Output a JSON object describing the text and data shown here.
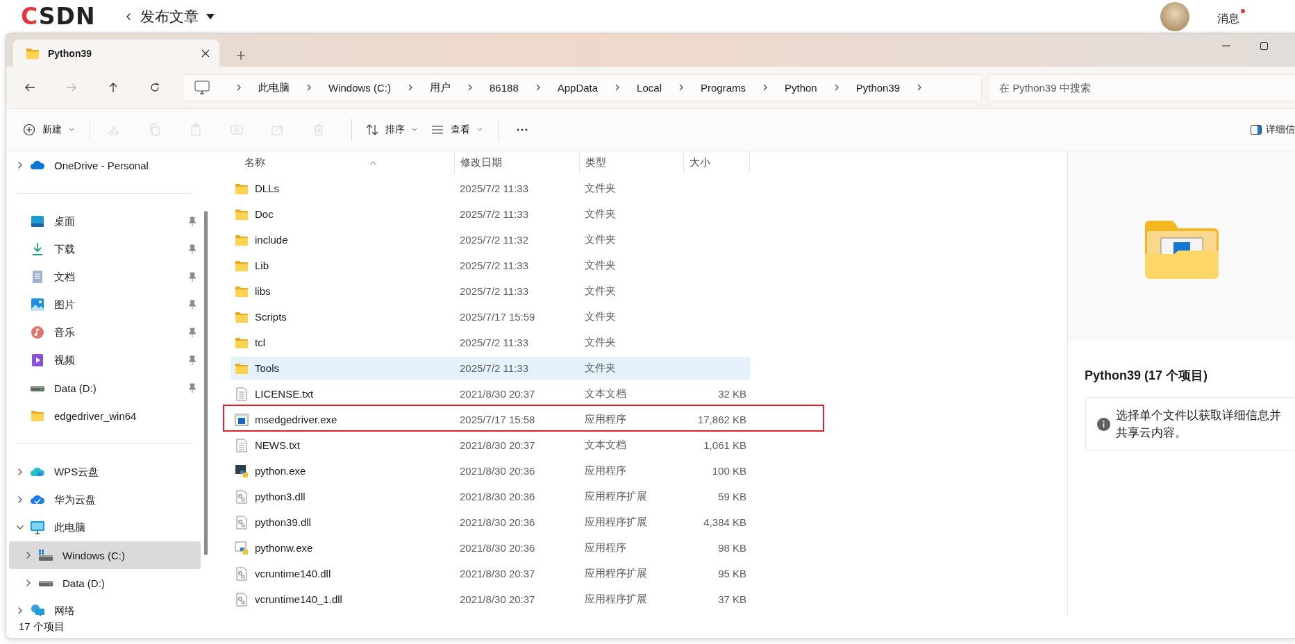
{
  "csdn_bar": {
    "logo": "CSDN",
    "page_title": "发布文章",
    "messages": "消息",
    "unread": true
  },
  "explorer": {
    "tabs": [
      {
        "label": "Python39",
        "selected": true
      }
    ],
    "nav_buttons": [
      {
        "kind": "back",
        "disabled": false
      },
      {
        "kind": "forward",
        "disabled": true
      },
      {
        "kind": "up",
        "disabled": false
      },
      {
        "kind": "refresh",
        "disabled": false
      }
    ],
    "breadcrumb": [
      "此电脑",
      "Windows (C:)",
      "用户",
      "86188",
      "AppData",
      "Local",
      "Programs",
      "Python",
      "Python39"
    ],
    "search": {
      "placeholder": "在 Python39 中搜索"
    },
    "toolbar": [
      {
        "kind": "new",
        "label": "新建",
        "disabled": false
      },
      {
        "kind": "separator"
      },
      {
        "kind": "cut",
        "disabled": true
      },
      {
        "kind": "copy",
        "disabled": true
      },
      {
        "kind": "paste",
        "disabled": true
      },
      {
        "kind": "rename",
        "disabled": true
      },
      {
        "kind": "share",
        "disabled": true
      },
      {
        "kind": "delete",
        "disabled": true
      },
      {
        "kind": "separator"
      },
      {
        "kind": "sort",
        "label": "排序",
        "disabled": false
      },
      {
        "kind": "view",
        "label": "查看",
        "disabled": false
      },
      {
        "kind": "separator"
      },
      {
        "kind": "more",
        "disabled": false
      }
    ],
    "details_toggle": {
      "label": "详细信"
    },
    "sidebar": {
      "sections": [
        [
          {
            "label": "OneDrive - Personal",
            "kind": "onedrive",
            "expanded": false,
            "selected": false
          }
        ],
        [
          {
            "label": "桌面",
            "kind": "desktop",
            "pinned": true,
            "selected": false
          },
          {
            "label": "下载",
            "kind": "download",
            "pinned": true,
            "selected": false
          },
          {
            "label": "文档",
            "kind": "documents",
            "pinned": true,
            "selected": false
          },
          {
            "label": "图片",
            "kind": "pictures",
            "pinned": true,
            "selected": false
          },
          {
            "label": "音乐",
            "kind": "music",
            "pinned": true,
            "selected": false
          },
          {
            "label": "视频",
            "kind": "videos",
            "pinned": true,
            "selected": false
          },
          {
            "label": "Data (D:)",
            "kind": "drive",
            "pinned": true,
            "selected": false
          },
          {
            "label": "edgedriver_win64",
            "kind": "folder",
            "pinned": false,
            "selected": false
          }
        ],
        [
          {
            "label": "WPS云盘",
            "kind": "wps",
            "expanded": false,
            "selected": false
          },
          {
            "label": "华为云盘",
            "kind": "huawei",
            "expanded": false,
            "selected": false
          },
          {
            "label": "此电脑",
            "kind": "pc",
            "expanded": true,
            "selected": false,
            "children": [
              {
                "label": "Windows (C:)",
                "kind": "system_drive",
                "expanded": false,
                "selected": true
              },
              {
                "label": "Data (D:)",
                "kind": "drive",
                "expanded": false,
                "selected": false
              }
            ]
          },
          {
            "label": "网络",
            "kind": "network",
            "expanded": false,
            "selected": false
          }
        ]
      ]
    },
    "columns": [
      {
        "label": "名称",
        "sorted": true
      },
      {
        "label": "修改日期",
        "sorted": false
      },
      {
        "label": "类型",
        "sorted": false
      },
      {
        "label": "大小",
        "sorted": false
      }
    ],
    "rows": [
      {
        "name": "DLLs",
        "modified": "2025/7/2 11:33",
        "type": "文件夹",
        "kind": "folder",
        "hovered": false,
        "outlined": false
      },
      {
        "name": "Doc",
        "modified": "2025/7/2 11:33",
        "type": "文件夹",
        "kind": "folder",
        "hovered": false,
        "outlined": false
      },
      {
        "name": "include",
        "modified": "2025/7/2 11:32",
        "type": "文件夹",
        "kind": "folder",
        "hovered": false,
        "outlined": false
      },
      {
        "name": "Lib",
        "modified": "2025/7/2 11:33",
        "type": "文件夹",
        "kind": "folder",
        "hovered": false,
        "outlined": false
      },
      {
        "name": "libs",
        "modified": "2025/7/2 11:33",
        "type": "文件夹",
        "kind": "folder",
        "hovered": false,
        "outlined": false
      },
      {
        "name": "Scripts",
        "modified": "2025/7/17 15:59",
        "type": "文件夹",
        "kind": "folder",
        "hovered": false,
        "outlined": false
      },
      {
        "name": "tcl",
        "modified": "2025/7/2 11:33",
        "type": "文件夹",
        "kind": "folder",
        "hovered": false,
        "outlined": false
      },
      {
        "name": "Tools",
        "modified": "2025/7/2 11:33",
        "type": "文件夹",
        "kind": "folder",
        "hovered": true,
        "outlined": false
      },
      {
        "name": "LICENSE.txt",
        "modified": "2021/8/30 20:37",
        "type": "文本文档",
        "size": "32 KB",
        "kind": "text",
        "hovered": false,
        "outlined": false
      },
      {
        "name": "msedgedriver.exe",
        "modified": "2025/7/17 15:58",
        "type": "应用程序",
        "size": "17,862 KB",
        "kind": "exe",
        "hovered": false,
        "outlined": true
      },
      {
        "name": "NEWS.txt",
        "modified": "2021/8/30 20:37",
        "type": "文本文档",
        "size": "1,061 KB",
        "kind": "text",
        "hovered": false,
        "outlined": false
      },
      {
        "name": "python.exe",
        "modified": "2021/8/30 20:36",
        "type": "应用程序",
        "size": "100 KB",
        "kind": "python",
        "hovered": false,
        "outlined": false
      },
      {
        "name": "python3.dll",
        "modified": "2021/8/30 20:36",
        "type": "应用程序扩展",
        "size": "59 KB",
        "kind": "dll",
        "hovered": false,
        "outlined": false
      },
      {
        "name": "python39.dll",
        "modified": "2021/8/30 20:36",
        "type": "应用程序扩展",
        "size": "4,384 KB",
        "kind": "dll",
        "hovered": false,
        "outlined": false
      },
      {
        "name": "pythonw.exe",
        "modified": "2021/8/30 20:36",
        "type": "应用程序",
        "size": "98 KB",
        "kind": "pythonw",
        "hovered": false,
        "outlined": false
      },
      {
        "name": "vcruntime140.dll",
        "modified": "2021/8/30 20:37",
        "type": "应用程序扩展",
        "size": "95 KB",
        "kind": "dll",
        "hovered": false,
        "outlined": false
      },
      {
        "name": "vcruntime140_1.dll",
        "modified": "2021/8/30 20:37",
        "type": "应用程序扩展",
        "size": "37 KB",
        "kind": "dll",
        "hovered": false,
        "outlined": false
      }
    ],
    "details": {
      "title": "Python39 (17 个项目)",
      "info": "选择单个文件以获取详细信息并共享云内容。"
    },
    "status_bar": {
      "item_count": "17 个项目"
    }
  }
}
